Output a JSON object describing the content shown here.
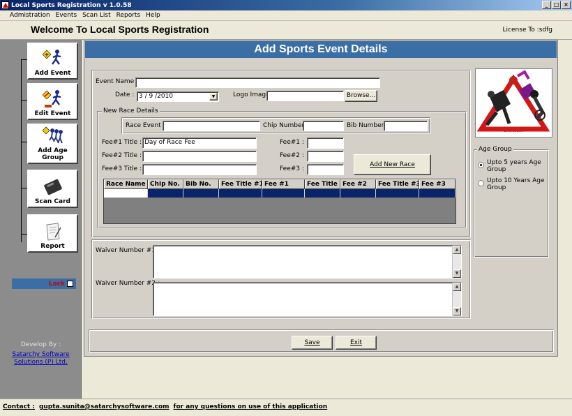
{
  "window": {
    "title": "Local Sports Registration v 1.0.58",
    "controls": [
      "_",
      "□",
      "×"
    ]
  },
  "menu": [
    "Admistration",
    "Events",
    "Scan List",
    "Reports",
    "Help"
  ],
  "header": {
    "welcome": "Welcome To Local Sports Registration",
    "license": "License To :sdfg"
  },
  "sidebar": {
    "items": [
      {
        "label": "Add Event",
        "icon": "runner-icon"
      },
      {
        "label": "Edit Event",
        "icon": "edit-runner-icon"
      },
      {
        "label": "Add Age Group",
        "icon": "group-runners-icon"
      },
      {
        "label": "Scan Card",
        "icon": "card-scanner-icon"
      },
      {
        "label": "Report",
        "icon": "report-icon"
      }
    ],
    "lock_label": "Lock",
    "develop_by": "Develop By :",
    "company": "Satarchy Software Solutions (P) Ltd."
  },
  "form": {
    "banner": "Add Sports Event Details",
    "event_name_label": "Event Name :",
    "event_name_value": "",
    "date_label": "Date :",
    "date_value": "3 / 9 /2010",
    "logo_image_label": "Logo Image",
    "logo_image_value": "",
    "browse_label": "Browse...",
    "new_race_legend": "New Race Details",
    "race_event_label": "Race Event :",
    "chip_number_label": "Chip Number :",
    "bib_number_label": "Bib Number :",
    "fee1_title_label": "Fee#1 Title :",
    "fee1_title_value": "Day of Race Fee",
    "fee2_title_label": "Fee#2 Title :",
    "fee3_title_label": "Fee#3 Title :",
    "fee1_label": "Fee#1 :",
    "fee2_label": "Fee#2 :",
    "fee3_label": "Fee#3 :",
    "add_race_label": "Add New Race",
    "grid_columns": [
      "Race Name",
      "Chip No.",
      "Bib No.",
      "Fee Title #1",
      "Fee #1",
      "Fee Title #",
      "Fee #2",
      "Fee Title #3",
      "Fee #3"
    ],
    "waiver1_label": "Waiver Number #1 :",
    "waiver2_label": "Waiver Number #2 :",
    "save_label": "Save",
    "exit_label": "Exit"
  },
  "age_group": {
    "legend": "Age Group",
    "options": [
      "Upto 5 years Age Group",
      "Upto 10 Years Age Group"
    ],
    "selected": 0
  },
  "logo_caption": "SATARCHY",
  "footer": {
    "contact_label": "Contact :",
    "email": "gupta.sunita@satarchysoftware.com",
    "note": "for any questions on use of this application"
  },
  "colors": {
    "banner": "#3a6ea5",
    "titlebar": "#0a246a",
    "selection": "#0a246a",
    "lock_text": "#cc0000"
  }
}
